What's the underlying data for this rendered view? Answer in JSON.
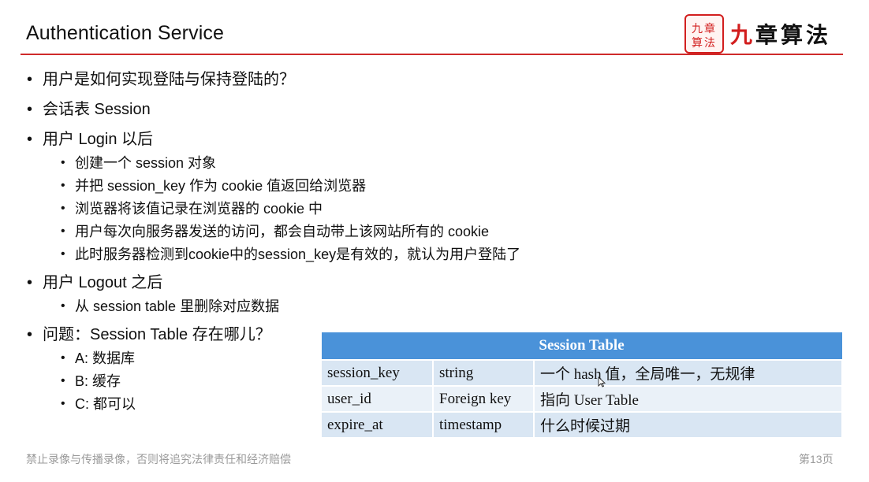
{
  "slide": {
    "title": "Authentication Service",
    "logo": {
      "seal_text": "九章算法",
      "brand_accent": "九",
      "brand_rest": "章算法"
    },
    "bullets": [
      {
        "text": "用户是如何实现登陆与保持登陆的？",
        "children": []
      },
      {
        "text": "会话表 Session",
        "children": []
      },
      {
        "text": "用户 Login 以后",
        "children": [
          "创建一个 session 对象",
          "并把 session_key 作为 cookie 值返回给浏览器",
          "浏览器将该值记录在浏览器的 cookie 中",
          "用户每次向服务器发送的访问，都会自动带上该网站所有的 cookie",
          "此时服务器检测到cookie中的session_key是有效的，就认为用户登陆了"
        ]
      },
      {
        "text": "用户 Logout 之后",
        "children": [
          "从 session table 里删除对应数据"
        ]
      },
      {
        "text": "问题：Session Table 存在哪儿？",
        "children": [
          "A: 数据库",
          "B: 缓存",
          "C: 都可以"
        ]
      }
    ],
    "table": {
      "title": "Session Table",
      "rows": [
        [
          "session_key",
          "string",
          "一个 hash 值，全局唯一，无规律"
        ],
        [
          "user_id",
          "Foreign key",
          "指向 User Table"
        ],
        [
          "expire_at",
          "timestamp",
          "什么时候过期"
        ]
      ]
    },
    "footer": "禁止录像与传播录像，否则将追究法律责任和经济赔偿",
    "page_number": "第13页"
  },
  "colors": {
    "accent_red": "#cf2a2a",
    "table_header": "#4a92d9",
    "table_row": "#d9e6f3",
    "footer_gray": "#9a9a9a"
  },
  "icons": {
    "cursor": "mouse-pointer-icon"
  }
}
